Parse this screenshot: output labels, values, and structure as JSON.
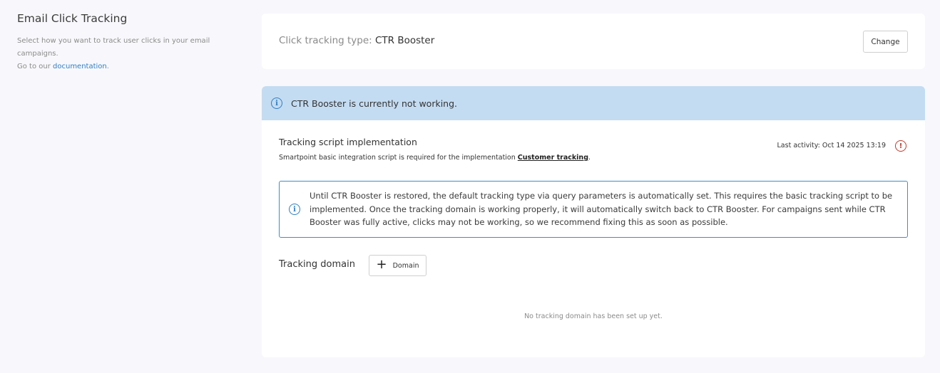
{
  "section": {
    "title": "Email Click Tracking",
    "desc_line1": "Select how you want to track user clicks in your email campaigns.",
    "desc_line2_prefix": "Go to our ",
    "desc_link": "documentation",
    "desc_line2_suffix": "."
  },
  "tracking_type": {
    "label": "Click tracking type: ",
    "value": "CTR Booster",
    "change_button": "Change"
  },
  "status": {
    "banner_text": "CTR Booster is currently not working.",
    "script_title": "Tracking script implementation",
    "script_desc": "Smartpoint basic integration script is required for the implementation ",
    "script_link": "Customer tracking",
    "script_desc_suffix": ".",
    "last_activity": "Last activity: Oct 14 2025 13:19",
    "notice": "Until CTR Booster is restored, the default tracking type via query parameters is automatically set. This requires the basic tracking script to be implemented. Once the tracking domain is working properly, it will automatically switch back to CTR Booster. For campaigns sent while CTR Booster was fully active, clicks may not be working, so we recommend fixing this as soon as possible.",
    "domain_label": "Tracking domain",
    "domain_button": "Domain",
    "empty_text": "No tracking domain has been set up yet."
  },
  "icons": {
    "info": "info-icon",
    "alert": "alert-circle-icon",
    "plus": "plus-icon"
  },
  "colors": {
    "banner_bg": "#c4dcf2",
    "accent": "#2f7fc4",
    "error": "#c0392b"
  }
}
